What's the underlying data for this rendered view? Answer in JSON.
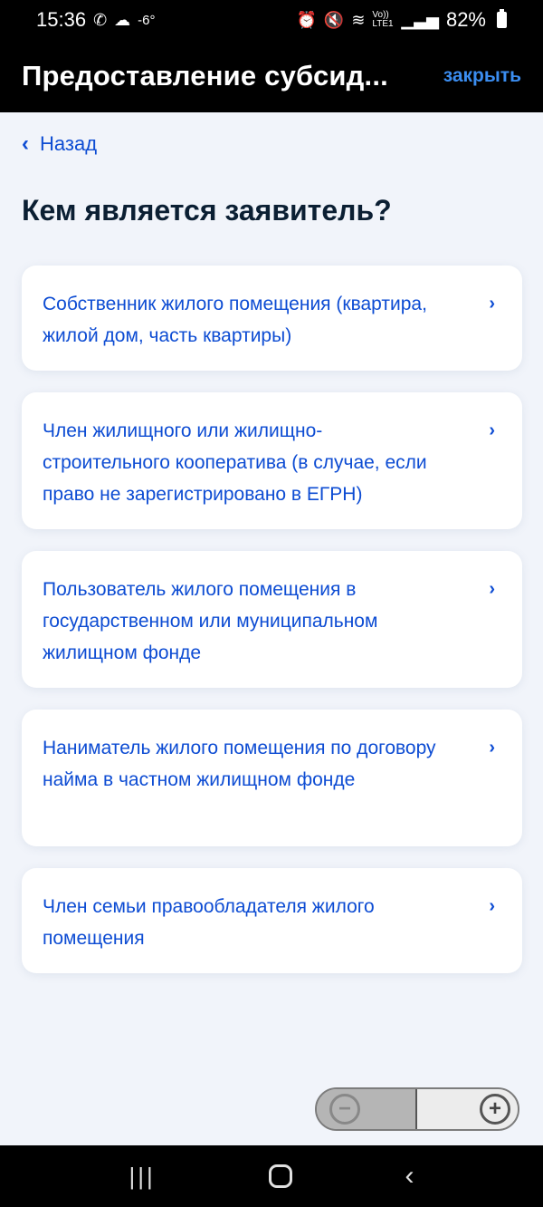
{
  "status_bar": {
    "time": "15:36",
    "temperature": "-6°",
    "battery": "82%",
    "icons_left": [
      "whatsapp-icon",
      "weather-icon"
    ],
    "icons_right": [
      "alarm-icon",
      "mute-icon",
      "wifi-icon",
      "volte-icon",
      "signal-icon",
      "battery-icon"
    ],
    "volte_text": "Vo)) LTE1"
  },
  "app_bar": {
    "title": "Предоставление субсид...",
    "close_label": "закрыть"
  },
  "back": {
    "label": "Назад"
  },
  "question": "Кем является заявитель?",
  "options": [
    {
      "label": "Собственник жилого помещения (квартира, жилой дом, часть квартиры)"
    },
    {
      "label": "Член жилищного или жилищно-строительного кооператива (в случае, если право не зарегистрировано в ЕГРН)"
    },
    {
      "label": "Пользователь жилого помещения в государственном или муниципальном жилищном фонде"
    },
    {
      "label": "Наниматель жилого помещения по договору найма в частном жилищном фонде"
    },
    {
      "label": "Член семьи правообладателя жилого помещения"
    }
  ],
  "zoom": {
    "out_symbol": "−",
    "in_symbol": "+"
  },
  "colors": {
    "accent": "#0d4cd3",
    "link": "#3b8df0",
    "background": "#f1f4fa",
    "heading": "#0b1f33"
  }
}
